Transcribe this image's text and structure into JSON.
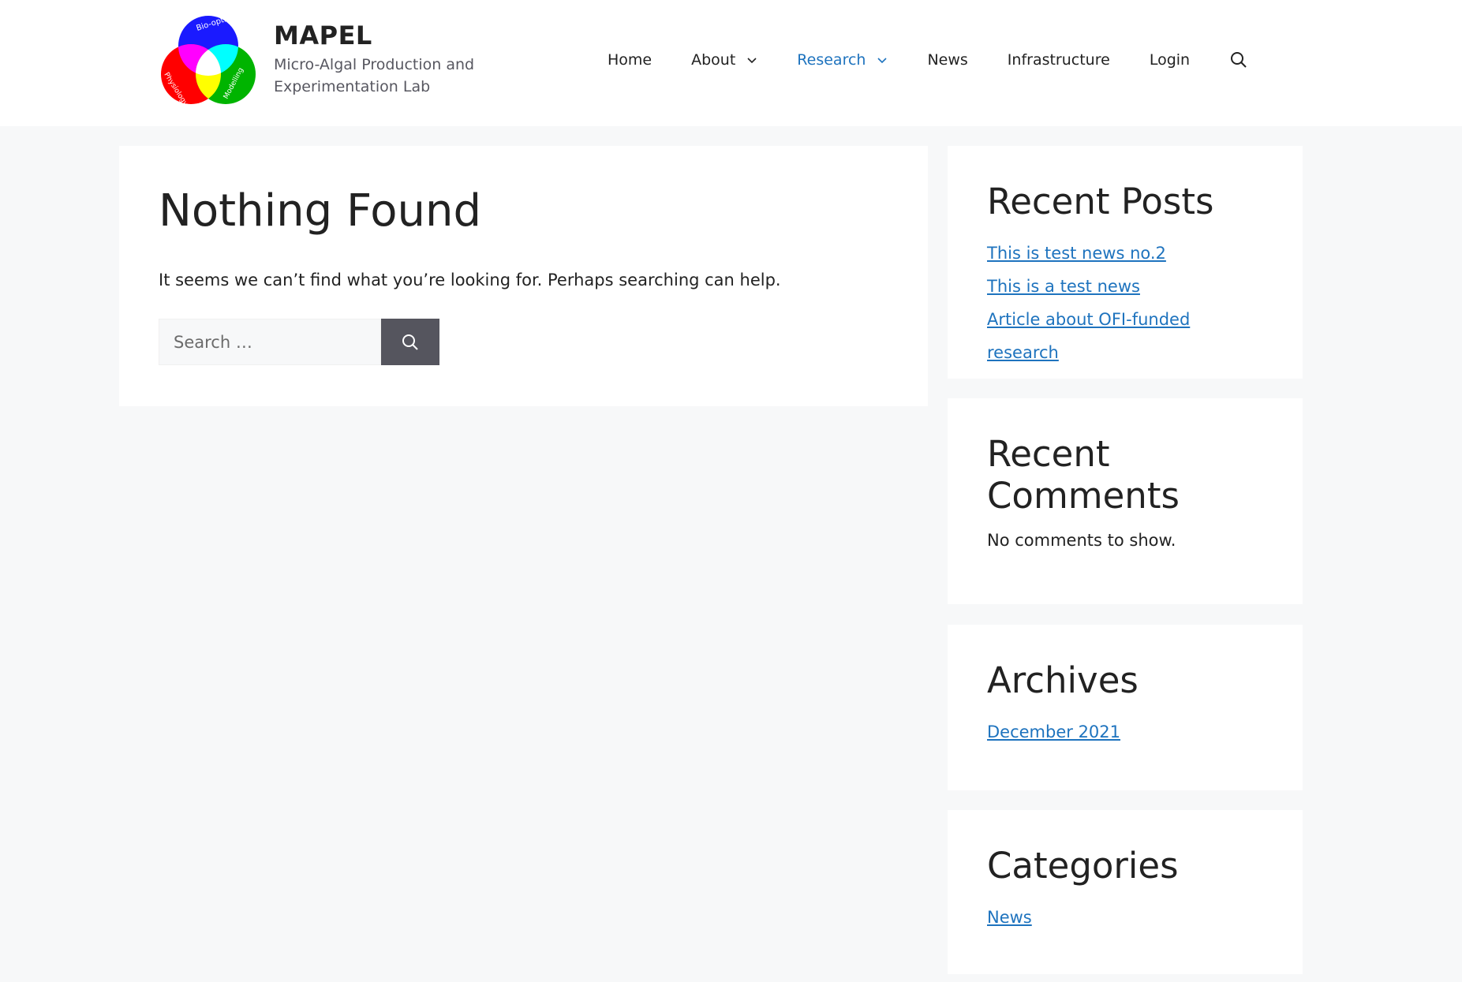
{
  "header": {
    "site_title": "MAPEL",
    "tagline": "Micro-Algal Production and Experimentation Lab",
    "logo": {
      "labels": [
        "Bio-optics",
        "Physiology",
        "Modelling"
      ],
      "colors": {
        "top": "#1a1aff",
        "left": "#ff0000",
        "right": "#00b400",
        "overlap_rb": "#ff00ff",
        "overlap_bg": "#00ffff",
        "overlap_rg": "#ffff00",
        "center": "#ffffff"
      }
    },
    "nav": {
      "home": "Home",
      "about": "About",
      "research": "Research",
      "news": "News",
      "infrastructure": "Infrastructure",
      "login": "Login",
      "search_icon": "search-icon"
    }
  },
  "main": {
    "title": "Nothing Found",
    "message": "It seems we can’t find what you’re looking for. Perhaps searching can help.",
    "search": {
      "placeholder": "Search …",
      "value": ""
    }
  },
  "sidebar": {
    "recent_posts": {
      "title": "Recent Posts",
      "items": [
        "This is test news no.2",
        "This is a test news",
        "Article about OFI-funded research"
      ]
    },
    "recent_comments": {
      "title": "Recent Comments",
      "text": "No comments to show."
    },
    "archives": {
      "title": "Archives",
      "items": [
        "December 2021"
      ]
    },
    "categories": {
      "title": "Categories",
      "items": [
        "News"
      ]
    }
  },
  "colors": {
    "accent": "#1e73be",
    "button": "#55555e",
    "background": "#f7f8f9"
  }
}
